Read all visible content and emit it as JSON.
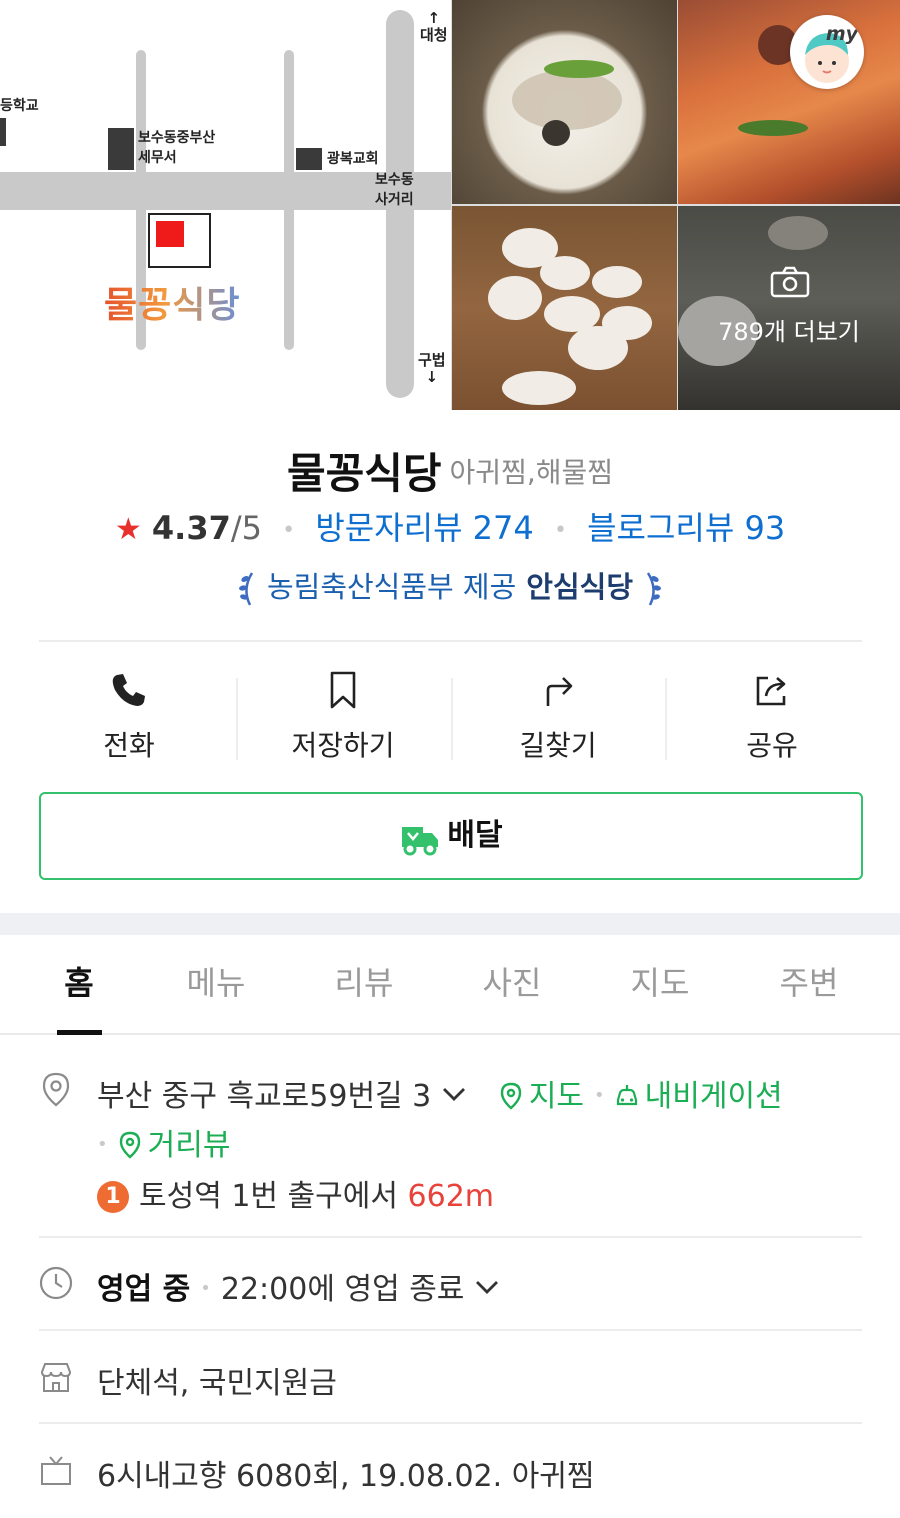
{
  "hero": {
    "map_labels": {
      "school": "등학교",
      "tax_office": "보수동중부산\n세무서",
      "church": "광복교회",
      "crossroad": "보수동\n사거리",
      "to_daecheong": "↑\n대청",
      "to_gubeop": "구법\n↓"
    },
    "map_logo": "물꽁식당",
    "more_photos_label": "789개 더보기",
    "my_badge": "my"
  },
  "place": {
    "name": "물꽁식당",
    "category": "아귀찜,해물찜",
    "rating": "4.37",
    "rating_max": "/5",
    "visitor_reviews": "방문자리뷰 274",
    "blog_reviews": "블로그리뷰 93",
    "cert_text": "농림축산식품부 제공",
    "cert_strong": "안심식당"
  },
  "actions": {
    "call": "전화",
    "save": "저장하기",
    "directions": "길찾기",
    "share": "공유",
    "delivery": "배달"
  },
  "tabs": [
    "홈",
    "메뉴",
    "리뷰",
    "사진",
    "지도",
    "주변"
  ],
  "info": {
    "address": "부산 중구 흑교로59번길 3",
    "map_link": "지도",
    "navigation_link": "내비게이션",
    "street_view_link": "거리뷰",
    "subway_line": "1",
    "subway_text": "토성역 1번 출구에서",
    "subway_distance": "662m",
    "status": "영업 중",
    "hours": "22:00에 영업 종료",
    "facilities": "단체석, 국민지원금",
    "tv": "6시내고향 6080회, 19.08.02. 아귀찜"
  },
  "colors": {
    "accent_green": "#1cae55",
    "link_blue": "#0e6fd1",
    "star_red": "#e8312d",
    "distance_red": "#e8433b",
    "subway_orange": "#ee6b32"
  }
}
